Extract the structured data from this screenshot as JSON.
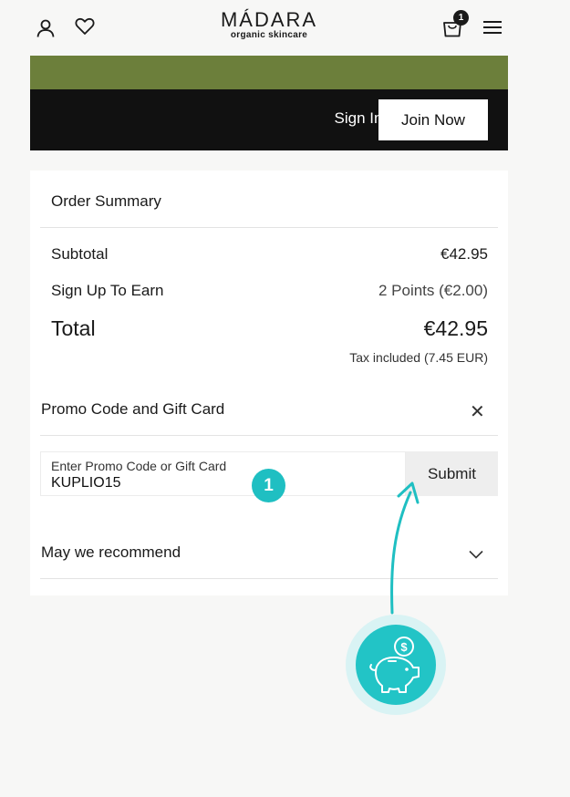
{
  "header": {
    "logo_main": "MÁDARA",
    "logo_sub": "organic skincare",
    "cart_count": "1",
    "icons": [
      "user-icon",
      "heart-icon",
      "cart-icon",
      "menu-icon"
    ]
  },
  "auth_bar": {
    "sign_in": "Sign In",
    "join_now": "Join Now"
  },
  "summary": {
    "title": "Order Summary",
    "rows": [
      {
        "label": "Subtotal",
        "value": "€42.95"
      },
      {
        "label": "Sign Up To Earn",
        "value": "2 Points (€2.00)"
      }
    ],
    "total_label": "Total",
    "total_value": "€42.95",
    "tax_note": "Tax included (7.45 EUR)"
  },
  "promo": {
    "title": "Promo Code and Gift Card",
    "placeholder": "Enter Promo Code or Gift Card",
    "value": "KUPLIO15",
    "submit_label": "Submit"
  },
  "recommend": {
    "label": "May we recommend"
  },
  "overlay": {
    "step_number": "1",
    "accent_color": "#1fbfc2",
    "icon": "piggy-bank-icon"
  },
  "colors": {
    "green_bar": "#6c7f3b",
    "dark_bar": "#111111"
  }
}
